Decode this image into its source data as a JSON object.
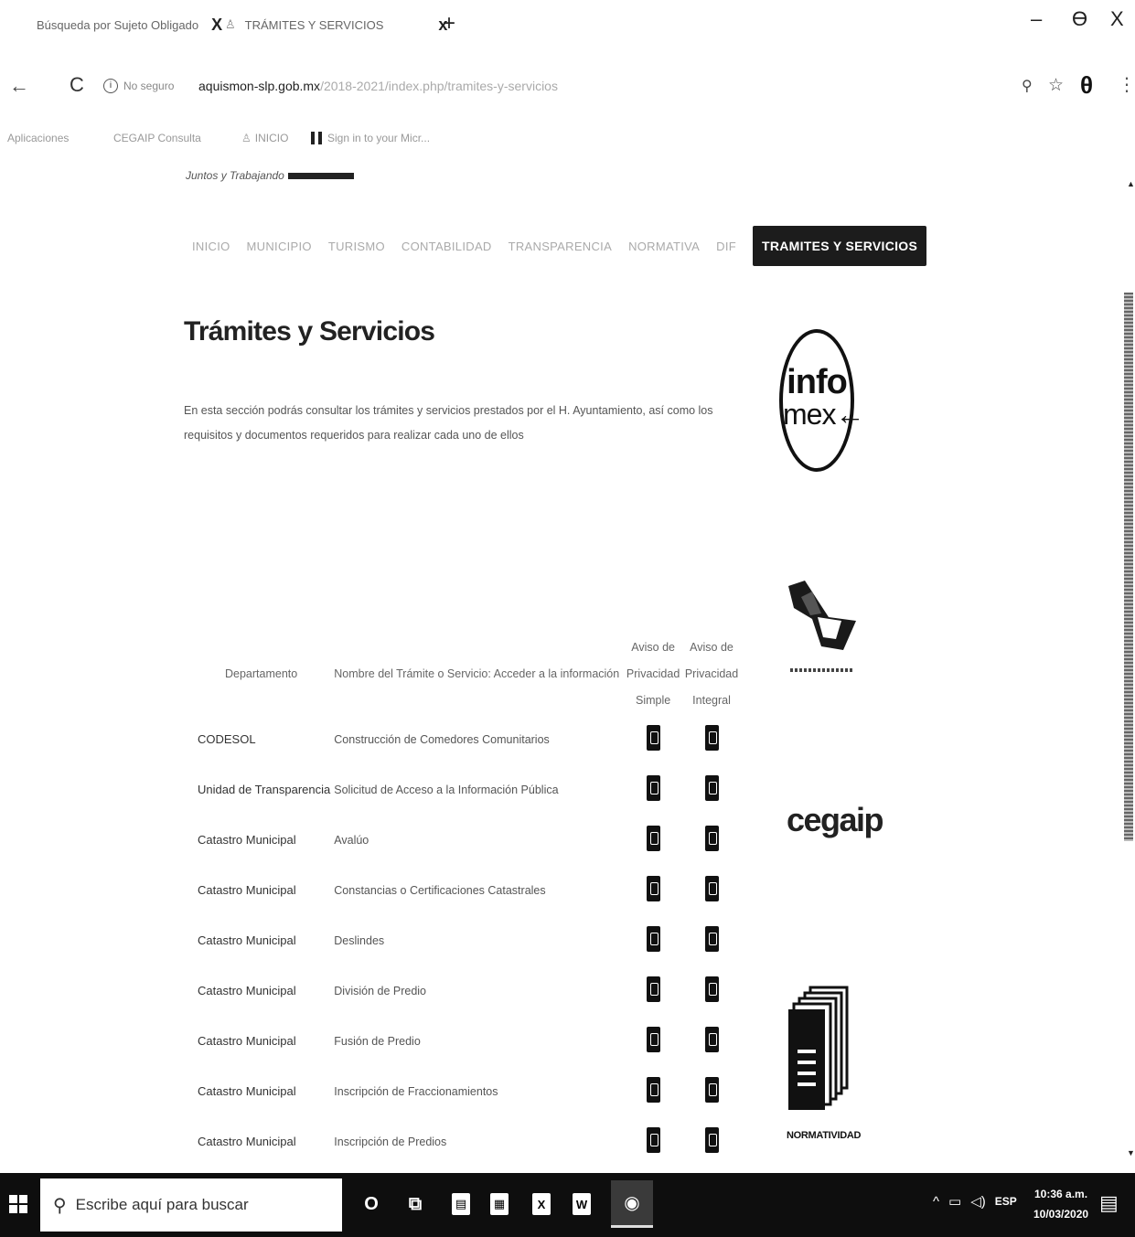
{
  "browser": {
    "tabs": [
      {
        "title": "Búsqueda por Sujeto Obligado",
        "close": "X"
      },
      {
        "title": "TRÁMITES Y SERVICIOS",
        "close": "x"
      }
    ],
    "new_tab": "+",
    "window_controls": {
      "minimize": "–",
      "maximize": "Ɵ",
      "close": "X"
    },
    "site_info": "No seguro",
    "url_domain": "aquismon-slp.gob.mx",
    "url_path": "/2018-2021/index.php/tramites-y-servicios",
    "bookmarks": [
      "Aplicaciones",
      "CEGAIP Consulta",
      "INICIO",
      "Sign in to your Micr..."
    ],
    "icons": {
      "back": "arrow-left",
      "reload": "reload",
      "zoom": "magnifier",
      "star": "star",
      "profile": "profile",
      "menu": "kebab"
    }
  },
  "site": {
    "logo_text": "Juntos y Trabajando",
    "nav": [
      {
        "label": "INICIO"
      },
      {
        "label": "MUNICIPIO"
      },
      {
        "label": "TURISMO"
      },
      {
        "label": "CONTABILIDAD"
      },
      {
        "label": "TRANSPARENCIA"
      },
      {
        "label": "NORMATIVA"
      },
      {
        "label": "DIF"
      }
    ],
    "nav_active": "TRAMITES Y SERVICIOS"
  },
  "main": {
    "title": "Trámites y Servicios",
    "intro": "En esta sección podrás consultar los trámites y servicios prestados por el H. Ayuntamiento, así como los requisitos y documentos requeridos para realizar cada uno de ellos"
  },
  "table": {
    "headers": {
      "department": "Departamento",
      "name": "Nombre del Trámite o Servicio: Acceder a la información",
      "aviso_simple": "Aviso de Privacidad Simple",
      "aviso_integral": "Aviso de Privacidad Integral"
    },
    "rows": [
      {
        "department": "CODESOL",
        "name": "Construcción de Comedores Comunitarios"
      },
      {
        "department": "Unidad de Transparencia",
        "name": "Solicitud de Acceso a la Información Pública"
      },
      {
        "department": "Catastro Municipal",
        "name": "Avalúo"
      },
      {
        "department": "Catastro Municipal",
        "name": "Constancias o Certificaciones Catastrales"
      },
      {
        "department": "Catastro Municipal",
        "name": "Deslindes"
      },
      {
        "department": "Catastro Municipal",
        "name": "División de Predio"
      },
      {
        "department": "Catastro Municipal",
        "name": "Fusión de Predio"
      },
      {
        "department": "Catastro Municipal",
        "name": "Inscripción de Fraccionamientos"
      },
      {
        "department": "Catastro Municipal",
        "name": "Inscripción de Predios"
      }
    ]
  },
  "sidebar": {
    "infomex": {
      "line1": "info",
      "line2": "mex"
    },
    "cegaip": "cegaip",
    "normatividad": "NORMATIVIDAD"
  },
  "taskbar": {
    "search_placeholder": "Escribe aquí para buscar",
    "tray_lang": "ESP",
    "time": "10:36 a.m.",
    "date": "10/03/2020",
    "apps": [
      "cortana",
      "task-view",
      "file-explorer",
      "calculator",
      "excel",
      "word",
      "chrome"
    ]
  }
}
